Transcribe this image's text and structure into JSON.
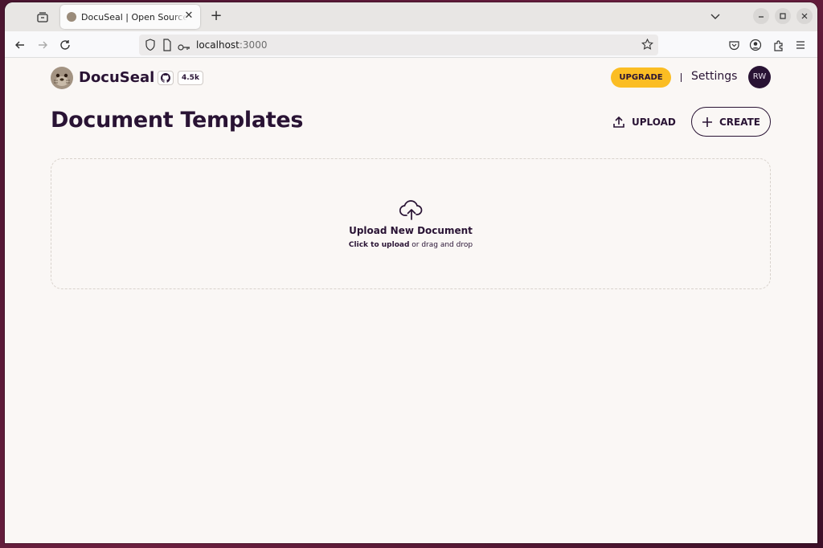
{
  "browser": {
    "tab_title": "DocuSeal | Open Source Document Signing",
    "url_host": "localhost",
    "url_port": ":3000"
  },
  "header": {
    "brand": "DocuSeal",
    "github_stars": "4.5k",
    "upgrade_label": "UPGRADE",
    "settings_label": "Settings",
    "avatar_initials": "RW"
  },
  "main": {
    "title": "Document Templates",
    "upload_label": "UPLOAD",
    "create_label": "CREATE",
    "dropzone": {
      "title": "Upload New Document",
      "click_text": "Click to upload",
      "rest_text": " or drag and drop"
    }
  },
  "colors": {
    "primary": "#291334",
    "upgrade_bg": "#fbbd23",
    "page_bg": "#faf7f5"
  }
}
